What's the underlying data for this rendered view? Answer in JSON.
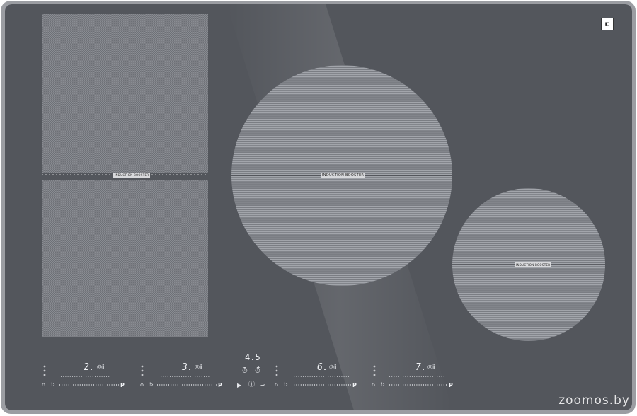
{
  "left_zone": {
    "booster_label": "INDUCTION BOOSTER"
  },
  "center_zone": {
    "booster_label": "INDUCTION BOOSTER"
  },
  "right_zone": {
    "booster_label": "INDUCTION BOOSTER"
  },
  "controls": {
    "zone1_level": "2.",
    "zone2_level": "3.",
    "timer_value": "4.5",
    "zone3_level": "6.",
    "zone4_level": "7.",
    "power_key": "P"
  },
  "watermark": "zoomos.by",
  "colors": {
    "glass": "#53565c",
    "zone_fill": "#7d8086",
    "frame": "#9b9da2"
  }
}
